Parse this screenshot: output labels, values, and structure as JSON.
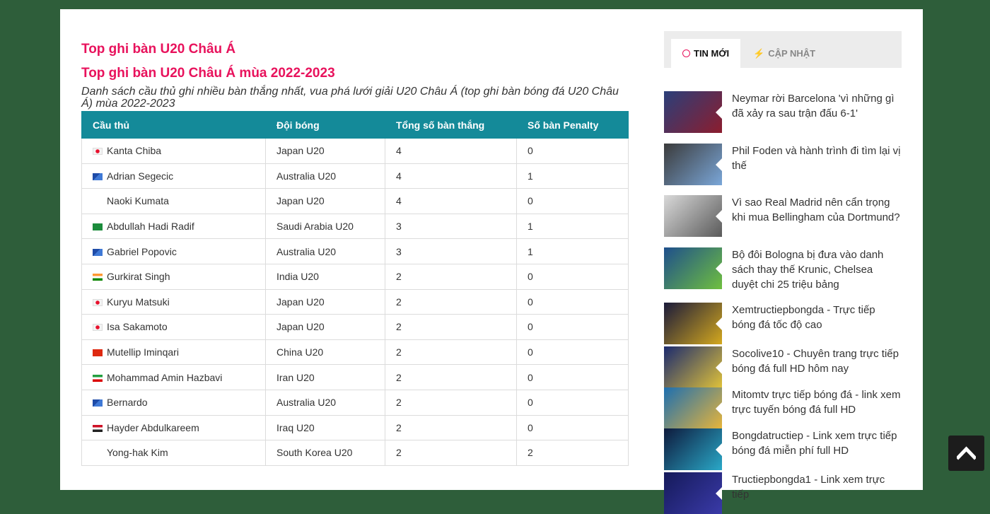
{
  "page": {
    "title1": "Top ghi bàn U20 Châu Á",
    "title2": "Top ghi bàn U20 Châu Á mùa 2022-2023",
    "description": "Danh sách cầu thủ ghi nhiều bàn thắng nhất, vua phá lưới giải U20 Châu Á (top ghi bàn bóng đá U20 Châu Á) mùa 2022-2023"
  },
  "table": {
    "headers": [
      "Cầu thủ",
      "Đội bóng",
      "Tổng số bàn thắng",
      "Số bàn Penalty"
    ],
    "rows": [
      {
        "player": "Kanta Chiba",
        "flag": "jp",
        "team": "Japan U20",
        "goals": "4",
        "penalty": "0"
      },
      {
        "player": "Adrian Segecic",
        "flag": "au",
        "team": "Australia U20",
        "goals": "4",
        "penalty": "1"
      },
      {
        "player": "Naoki Kumata",
        "flag": "none",
        "team": "Japan U20",
        "goals": "4",
        "penalty": "0"
      },
      {
        "player": "Abdullah Hadi Radif",
        "flag": "sa",
        "team": "Saudi Arabia U20",
        "goals": "3",
        "penalty": "1"
      },
      {
        "player": "Gabriel Popovic",
        "flag": "au",
        "team": "Australia U20",
        "goals": "3",
        "penalty": "1"
      },
      {
        "player": "Gurkirat Singh",
        "flag": "in",
        "team": "India U20",
        "goals": "2",
        "penalty": "0"
      },
      {
        "player": "Kuryu Matsuki",
        "flag": "jp",
        "team": "Japan U20",
        "goals": "2",
        "penalty": "0"
      },
      {
        "player": "Isa Sakamoto",
        "flag": "jp",
        "team": "Japan U20",
        "goals": "2",
        "penalty": "0"
      },
      {
        "player": "Mutellip Iminqari",
        "flag": "cn",
        "team": "China U20",
        "goals": "2",
        "penalty": "0"
      },
      {
        "player": "Mohammad Amin Hazbavi",
        "flag": "ir",
        "team": "Iran U20",
        "goals": "2",
        "penalty": "0"
      },
      {
        "player": "Bernardo",
        "flag": "au",
        "team": "Australia U20",
        "goals": "2",
        "penalty": "0"
      },
      {
        "player": "Hayder Abdulkareem",
        "flag": "iq",
        "team": "Iraq U20",
        "goals": "2",
        "penalty": "0"
      },
      {
        "player": "Yong-hak Kim",
        "flag": "none",
        "team": "South Korea U20",
        "goals": "2",
        "penalty": "2"
      }
    ]
  },
  "sidebar": {
    "tabs": [
      {
        "label": "TIN MỚI",
        "icon": "clock-icon"
      },
      {
        "label": "CẬP NHẬT",
        "icon": "bolt-icon"
      }
    ],
    "news": [
      {
        "title": "Neymar rời Barcelona 'vì những gì đã xảy ra sau trận đấu 6-1'",
        "thumb": [
          "#2a3f7a",
          "#8c1d2e"
        ]
      },
      {
        "title": "Phil Foden và hành trình đi tìm lại vị thế",
        "thumb": [
          "#3b3b3b",
          "#7aa6d8"
        ]
      },
      {
        "title": "Vì sao Real Madrid nên cẩn trọng khi mua Bellingham của Dortmund?",
        "thumb": [
          "#d9d9d9",
          "#5a5a5a"
        ]
      },
      {
        "title": "Bộ đôi Bologna bị đưa vào danh sách thay thế Krunic, Chelsea duyệt chi 25 triệu bảng",
        "thumb": [
          "#1e4f8c",
          "#6fbf3f"
        ]
      },
      {
        "title": "Xemtructiepbongda - Trực tiếp bóng đá tốc độ cao",
        "thumb": [
          "#1a1a3a",
          "#d4a81e"
        ]
      },
      {
        "title": "Socolive10 - Chuyên trang trực tiếp bóng đá full HD hôm nay",
        "thumb": [
          "#1b2a6e",
          "#e0c23a"
        ]
      },
      {
        "title": "Mitomtv trực tiếp bóng đá - link xem trực tuyến bóng đá full HD",
        "thumb": [
          "#1d6fb0",
          "#e8b53a"
        ]
      },
      {
        "title": "Bongdatructiep - Link xem trực tiếp bóng đá miễn phí full HD",
        "thumb": [
          "#0e1a3c",
          "#2aa8c8"
        ]
      },
      {
        "title": "Tructiepbongda1 - Link xem trực tiếp",
        "thumb": [
          "#151a5a",
          "#3a3aa8"
        ]
      }
    ]
  }
}
